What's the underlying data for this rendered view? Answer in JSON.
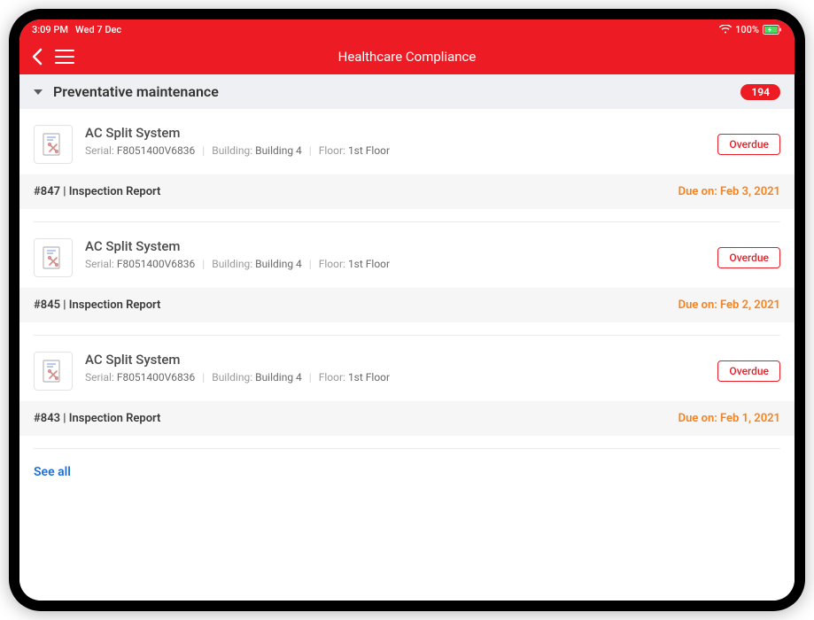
{
  "status_bar": {
    "time": "3:09 PM",
    "date": "Wed 7 Dec",
    "battery": "100%"
  },
  "nav": {
    "title": "Healthcare Compliance"
  },
  "section": {
    "title": "Preventative maintenance",
    "count": "194"
  },
  "labels": {
    "serial": "Serial:",
    "building": "Building:",
    "floor": "Floor:",
    "due_prefix": "Due on:",
    "overdue": "Overdue",
    "see_all": "See all"
  },
  "items": [
    {
      "title": "AC Split System",
      "serial": "F8051400V6836",
      "building": "Building 4",
      "floor": "1st Floor",
      "status": "Overdue",
      "report": "#847 | Inspection Report",
      "due": "Feb 3, 2021"
    },
    {
      "title": "AC Split System",
      "serial": "F8051400V6836",
      "building": "Building 4",
      "floor": "1st Floor",
      "status": "Overdue",
      "report": "#845 | Inspection Report",
      "due": "Feb 2, 2021"
    },
    {
      "title": "AC Split System",
      "serial": "F8051400V6836",
      "building": "Building 4",
      "floor": "1st Floor",
      "status": "Overdue",
      "report": "#843 | Inspection Report",
      "due": "Feb 1, 2021"
    }
  ]
}
